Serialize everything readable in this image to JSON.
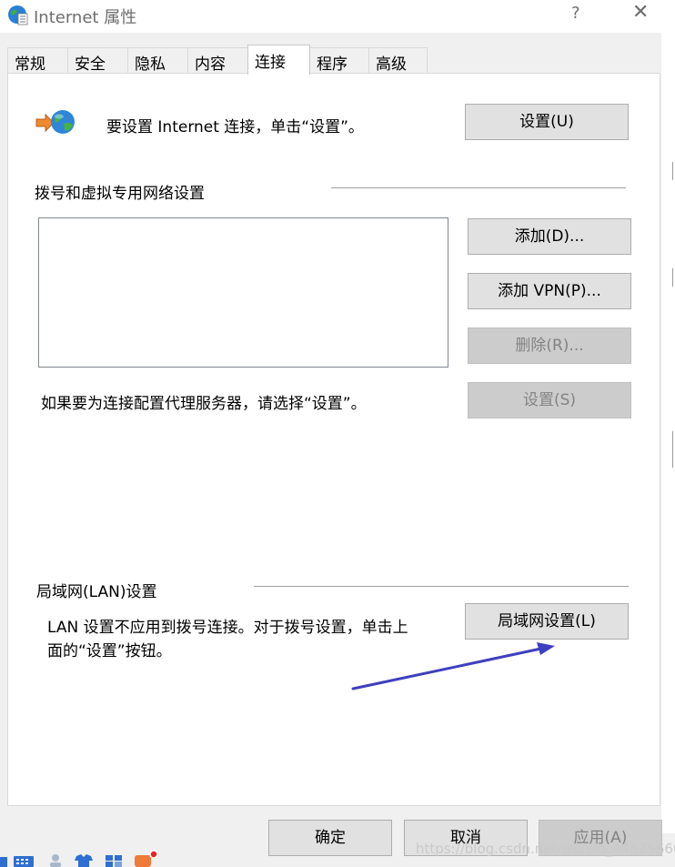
{
  "window": {
    "title": "Internet 属性",
    "help_label": "?",
    "close_label": "✕"
  },
  "tabs": [
    {
      "label": "常规"
    },
    {
      "label": "安全"
    },
    {
      "label": "隐私"
    },
    {
      "label": "内容"
    },
    {
      "label": "连接"
    },
    {
      "label": "程序"
    },
    {
      "label": "高级"
    }
  ],
  "active_tab": "连接",
  "setup": {
    "description": "要设置 Internet 连接，单击“设置”。",
    "button": "设置(U)"
  },
  "dialup": {
    "heading": "拨号和虚拟专用网络设置",
    "add_button": "添加(D)...",
    "add_vpn_button": "添加 VPN(P)...",
    "remove_button": "删除(R)...",
    "settings_button": "设置(S)",
    "proxy_note": "如果要为连接配置代理服务器，请选择“设置”。"
  },
  "lan": {
    "heading": "局域网(LAN)设置",
    "note_line1": "LAN 设置不应用到拨号连接。对于拨号设置，单击上",
    "note_line2": "面的“设置”按钮。",
    "button": "局域网设置(L)"
  },
  "footer": {
    "ok": "确定",
    "cancel": "取消",
    "apply": "应用(A)"
  },
  "watermark": "https://blog.csdn.net/weixin_44575660",
  "colors": {
    "annotation_arrow": "#3f3fbf",
    "button_face": "#e1e1e1",
    "disabled_text": "#838383"
  }
}
